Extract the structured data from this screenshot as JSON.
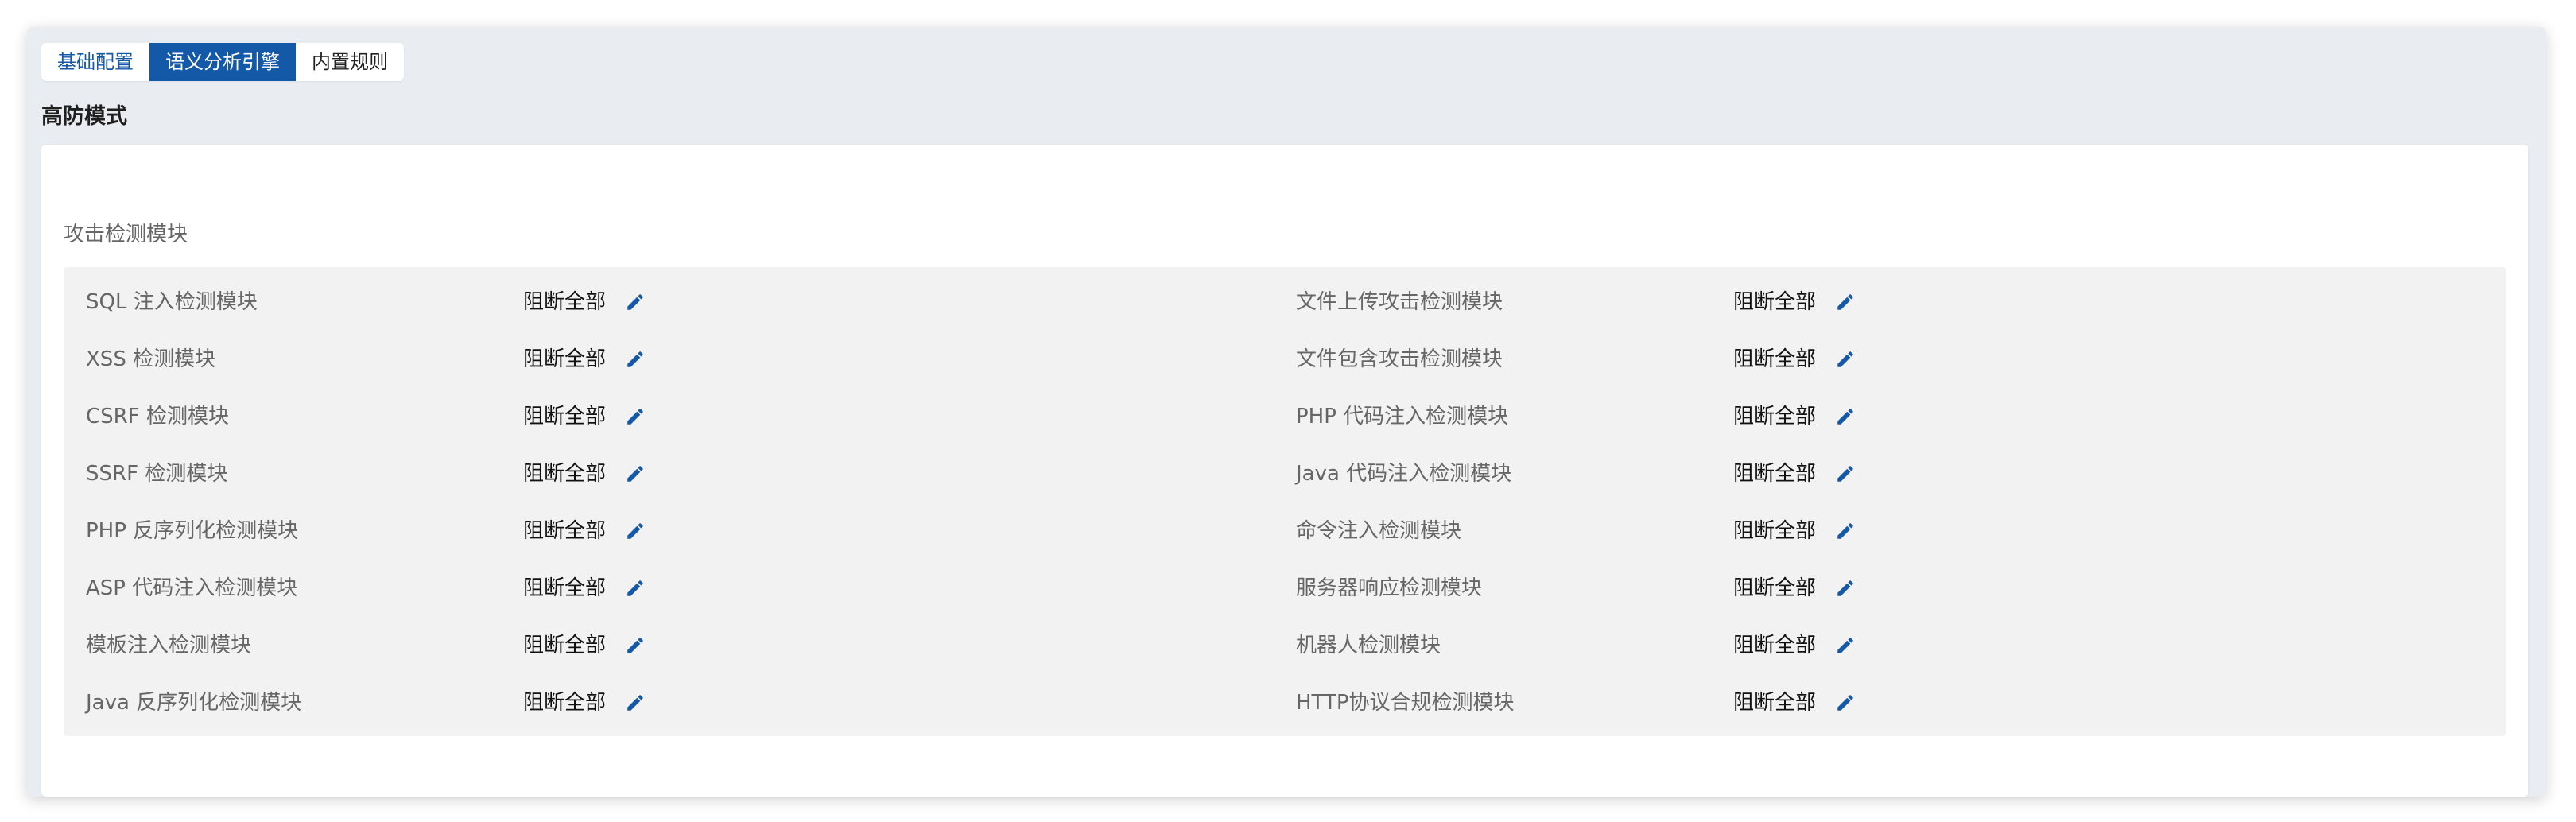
{
  "tabs": [
    {
      "label": "基础配置",
      "active": false
    },
    {
      "label": "语义分析引擎",
      "active": true
    },
    {
      "label": "内置规则",
      "active": false
    }
  ],
  "section": {
    "title": "高防模式"
  },
  "card": {
    "title": "攻击检测模块"
  },
  "modules_left": [
    {
      "name": "SQL 注入检测模块",
      "value": "阻断全部"
    },
    {
      "name": "XSS 检测模块",
      "value": "阻断全部"
    },
    {
      "name": "CSRF 检测模块",
      "value": "阻断全部"
    },
    {
      "name": "SSRF 检测模块",
      "value": "阻断全部"
    },
    {
      "name": "PHP 反序列化检测模块",
      "value": "阻断全部"
    },
    {
      "name": "ASP 代码注入检测模块",
      "value": "阻断全部"
    },
    {
      "name": "模板注入检测模块",
      "value": "阻断全部"
    },
    {
      "name": "Java 反序列化检测模块",
      "value": "阻断全部"
    }
  ],
  "modules_right": [
    {
      "name": "文件上传攻击检测模块",
      "value": "阻断全部"
    },
    {
      "name": "文件包含攻击检测模块",
      "value": "阻断全部"
    },
    {
      "name": "PHP 代码注入检测模块",
      "value": "阻断全部"
    },
    {
      "name": "Java 代码注入检测模块",
      "value": "阻断全部"
    },
    {
      "name": "命令注入检测模块",
      "value": "阻断全部"
    },
    {
      "name": "服务器响应检测模块",
      "value": "阻断全部"
    },
    {
      "name": "机器人检测模块",
      "value": "阻断全部"
    },
    {
      "name": "HTTP协议合规检测模块",
      "value": "阻断全部"
    }
  ],
  "icons": {
    "edit": "pencil-icon"
  },
  "colors": {
    "accent": "#1458a8",
    "panel_bg": "#e9edf2",
    "module_bg": "#f2f2f2"
  }
}
